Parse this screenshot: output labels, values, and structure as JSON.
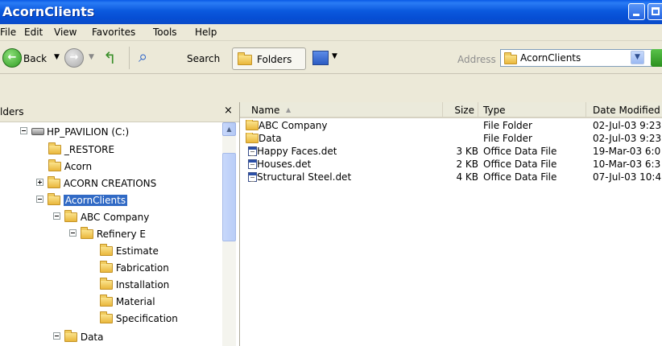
{
  "window": {
    "title": "AcornClients"
  },
  "menu": [
    "File",
    "Edit",
    "View",
    "Favorites",
    "Tools",
    "Help"
  ],
  "toolbar": {
    "back": "Back",
    "search": "Search",
    "folders": "Folders",
    "address_label": "Address",
    "address_value": "AcornClients"
  },
  "tree": {
    "header": "lders",
    "close": "×",
    "items": [
      {
        "label": "HP_PAVILION (C:)",
        "icon": "drive-icon",
        "expander": "minus"
      },
      {
        "label": "_RESTORE",
        "icon": "folder-icon"
      },
      {
        "label": "Acorn",
        "icon": "folder-icon"
      },
      {
        "label": "ACORN CREATIONS",
        "icon": "folder-icon",
        "expander": "plus"
      },
      {
        "label": "AcornClients",
        "icon": "folder-open-icon",
        "expander": "minus",
        "selected": true
      },
      {
        "label": "ABC Company",
        "icon": "folder-icon",
        "expander": "minus"
      },
      {
        "label": "Refinery E",
        "icon": "folder-icon",
        "expander": "minus"
      },
      {
        "label": "Estimate",
        "icon": "folder-icon"
      },
      {
        "label": "Fabrication",
        "icon": "folder-icon"
      },
      {
        "label": "Installation",
        "icon": "folder-icon"
      },
      {
        "label": "Material",
        "icon": "folder-icon"
      },
      {
        "label": "Specification",
        "icon": "folder-icon"
      },
      {
        "label": "Data",
        "icon": "folder-icon",
        "expander": "minus"
      }
    ]
  },
  "list": {
    "columns": [
      "Name",
      "Size",
      "Type",
      "Date Modified"
    ],
    "rows": [
      {
        "icon": "folder-icon",
        "name": "ABC Company",
        "size": "",
        "type": "File Folder",
        "date": "02-Jul-03 9:23"
      },
      {
        "icon": "folder-icon",
        "name": "Data",
        "size": "",
        "type": "File Folder",
        "date": "02-Jul-03 9:23"
      },
      {
        "icon": "file-icon",
        "name": "Happy Faces.det",
        "size": "3 KB",
        "type": "Office Data File",
        "date": "19-Mar-03 6:0"
      },
      {
        "icon": "file-icon",
        "name": "Houses.det",
        "size": "2 KB",
        "type": "Office Data File",
        "date": "10-Mar-03 6:3"
      },
      {
        "icon": "file-icon",
        "name": "Structural Steel.det",
        "size": "4 KB",
        "type": "Office Data File",
        "date": "07-Jul-03 10:4"
      }
    ]
  },
  "colors": {
    "titlebar": "#0b59de",
    "selection": "#316ac5",
    "chrome": "#ece9d8"
  }
}
